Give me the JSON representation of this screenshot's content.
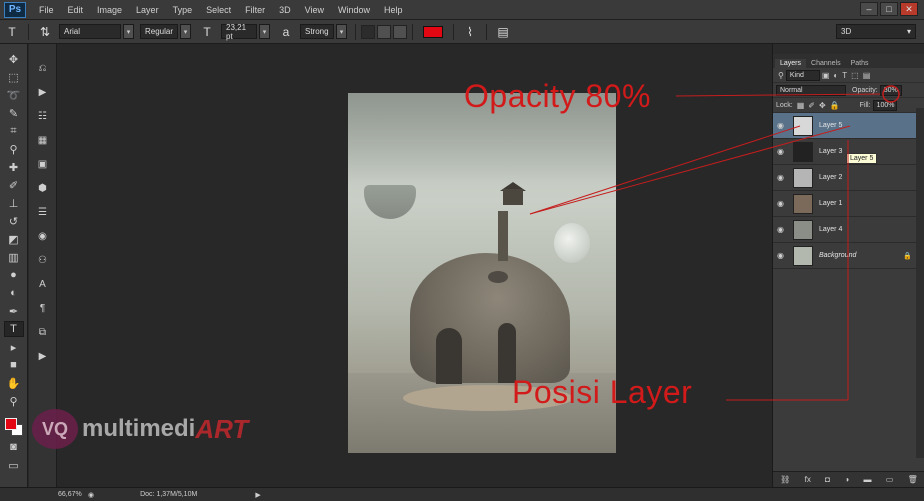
{
  "app": {
    "logo": "Ps",
    "menu": [
      "File",
      "Edit",
      "Image",
      "Layer",
      "Type",
      "Select",
      "Filter",
      "3D",
      "View",
      "Window",
      "Help"
    ],
    "window_controls": [
      "–",
      "□",
      "✕"
    ]
  },
  "options_bar": {
    "font_family": "Arial",
    "font_style": "Regular",
    "font_size": "23,21 pt",
    "antialias": "Strong",
    "color": "#e30613",
    "workspace": "3D"
  },
  "tools": {
    "icons": [
      "move-icon",
      "marquee-icon",
      "lasso-icon",
      "quick-select-icon",
      "crop-icon",
      "eyedropper-icon",
      "healing-icon",
      "brush-icon",
      "stamp-icon",
      "history-brush-icon",
      "eraser-icon",
      "gradient-icon",
      "blur-icon",
      "dodge-icon",
      "pen-icon",
      "type-icon",
      "path-select-icon",
      "shape-icon",
      "hand-icon",
      "zoom-icon"
    ],
    "foreground": "#e30613",
    "background": "#ffffff"
  },
  "callouts": {
    "opacity": "Opacity 80%",
    "posisi": "Posisi Layer"
  },
  "watermark": {
    "logo": "VQ",
    "text_a": "multimedi",
    "text_b": "ART"
  },
  "layers_panel": {
    "tabs": [
      "Layers",
      "Channels",
      "Paths"
    ],
    "kind": "Kind",
    "blend_mode": "Normal",
    "opacity_label": "Opacity:",
    "opacity_value": "80%",
    "lock_label": "Lock:",
    "fill_label": "Fill:",
    "fill_value": "100%",
    "layers": [
      {
        "name": "Layer 5",
        "selected": true
      },
      {
        "name": "Layer 3",
        "selected": false
      },
      {
        "name": "Layer 2",
        "selected": false
      },
      {
        "name": "Layer 1",
        "selected": false
      },
      {
        "name": "Layer 4",
        "selected": false
      },
      {
        "name": "Background",
        "selected": false
      }
    ],
    "tooltip": "Layer 5"
  },
  "status": {
    "zoom": "66,67%",
    "doc": "Doc: 1,37M/5,10M"
  }
}
